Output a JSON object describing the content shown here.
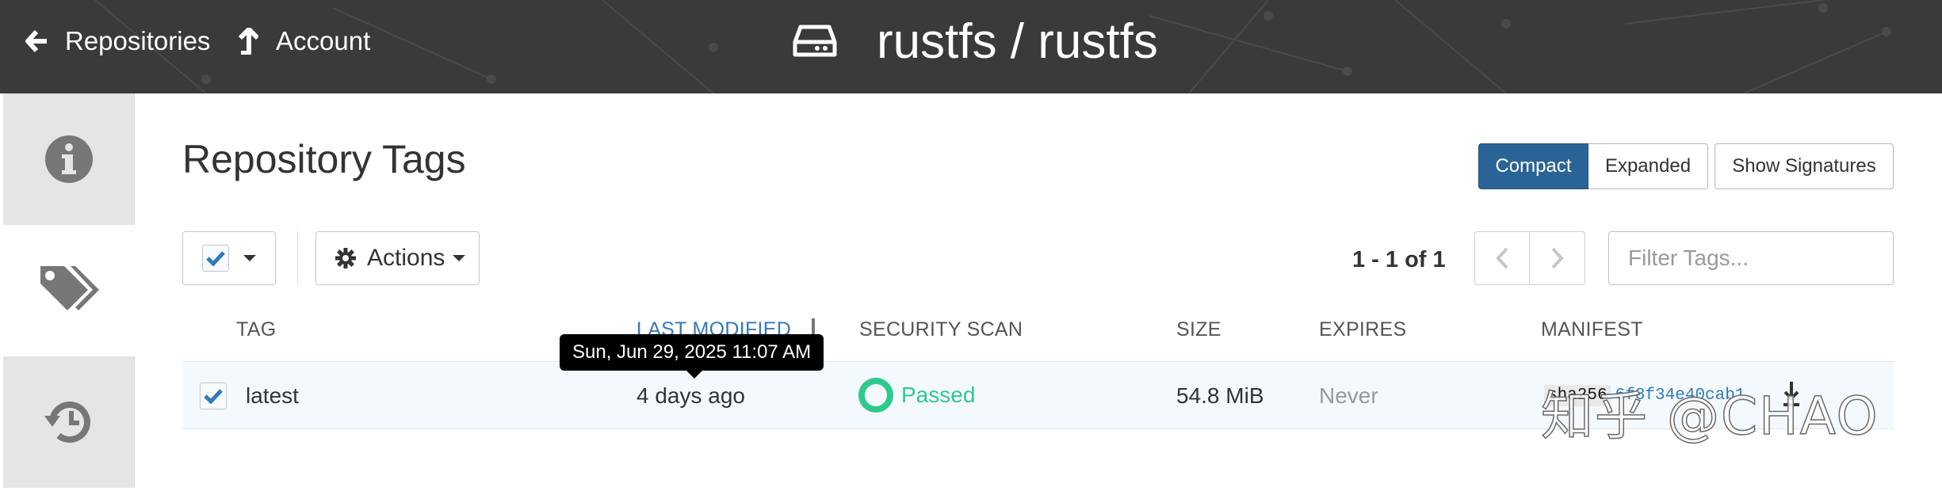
{
  "header": {
    "back_label": "Repositories",
    "account_label": "Account",
    "repo_title": "rustfs / rustfs"
  },
  "main": {
    "title": "Repository Tags",
    "view_modes": [
      {
        "label": "Compact",
        "active": true
      },
      {
        "label": "Expanded",
        "active": false
      }
    ],
    "show_signatures_label": "Show Signatures",
    "actions_label": "Actions",
    "pagination": "1 - 1 of 1",
    "filter_placeholder": "Filter Tags..."
  },
  "table": {
    "columns": {
      "tag": "TAG",
      "last_modified": "LAST MODIFIED",
      "security_scan": "SECURITY SCAN",
      "size": "SIZE",
      "expires": "EXPIRES",
      "manifest": "MANIFEST"
    },
    "rows": [
      {
        "selected": true,
        "tag": "latest",
        "last_modified": "4 days ago",
        "security_scan": "Passed",
        "size": "54.8 MiB",
        "expires": "Never",
        "manifest_algo": "sha256",
        "manifest_digest": "6f8f34e40cab1"
      }
    ]
  },
  "tooltip": "Sun, Jun 29, 2025 11:07 AM",
  "watermark": "知乎 @CHAO",
  "colors": {
    "header_bg": "#3a3a3a",
    "primary": "#2a6496",
    "link": "#337ab7",
    "passed": "#2fc98e",
    "icon": "#777777"
  },
  "icons": {
    "back": "arrow-left-icon",
    "account": "arrow-up-icon",
    "repo": "hard-drive-icon",
    "info": "info-circle-icon",
    "tags": "tags-icon",
    "history": "history-icon",
    "actions": "gear-icon",
    "download": "download-icon"
  }
}
